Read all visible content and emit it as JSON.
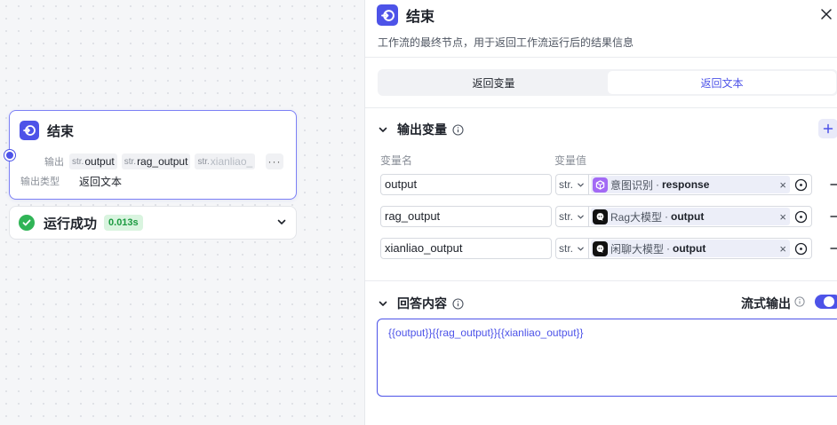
{
  "canvas_node": {
    "title": "结束",
    "output_label": "输出",
    "outputs": [
      {
        "type": "str.",
        "name": "output"
      },
      {
        "type": "str.",
        "name": "rag_output"
      },
      {
        "type": "str.",
        "name": "xianliao_"
      }
    ],
    "more_label": "···",
    "output_type_label": "输出类型",
    "output_type_value": "返回文本"
  },
  "run_status": {
    "text": "运行成功",
    "time": "0.013s"
  },
  "panel": {
    "title": "结束",
    "description": "工作流的最终节点，用于返回工作流运行后的结果信息",
    "tabs": [
      {
        "label": "返回变量",
        "active": false
      },
      {
        "label": "返回文本",
        "active": true
      }
    ],
    "output_section": {
      "title": "输出变量",
      "col_name": "变量名",
      "col_value": "变量值",
      "rows": [
        {
          "name": "output",
          "type": "str.",
          "node": "意图识别",
          "sep": "·",
          "var": "response",
          "icon": "purple-cube-icon"
        },
        {
          "name": "rag_output",
          "type": "str.",
          "node": "Rag大模型",
          "sep": "·",
          "var": "output",
          "icon": "llm-icon"
        },
        {
          "name": "xianliao_output",
          "type": "str.",
          "node": "闲聊大模型",
          "sep": "·",
          "var": "output",
          "icon": "llm-icon"
        }
      ]
    },
    "answer_section": {
      "title": "回答内容",
      "stream_label": "流式输出",
      "stream_enabled": true,
      "content": "{{output}}{{rag_output}}{{xianliao_output}}"
    }
  },
  "colors": {
    "accent": "#4d53e8",
    "success": "#30b456",
    "success_bg": "#d9f4df"
  }
}
